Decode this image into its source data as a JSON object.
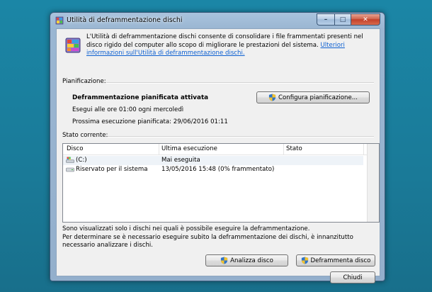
{
  "window": {
    "title": "Utilità di deframmentazione dischi",
    "controls": {
      "minimize": "–",
      "maximize": "□",
      "close": "✕"
    }
  },
  "header": {
    "description": "L'Utilità di deframmentazione dischi consente di consolidare i file frammentati presenti nel disco rigido del computer allo scopo di migliorare le prestazioni del sistema.",
    "link": "Ulteriori informazioni sull'Utilità di deframmentazione dischi."
  },
  "schedule": {
    "section_label": "Pianificazione:",
    "status": "Deframmentazione pianificata attivata",
    "frequency": "Esegui alle ore 01:00 ogni mercoledì",
    "next_run": "Prossima esecuzione pianificata: 29/06/2016 01:11",
    "configure_button": "Configura pianificazione..."
  },
  "current": {
    "section_label": "Stato corrente:",
    "columns": [
      "Disco",
      "Ultima esecuzione",
      "Stato"
    ],
    "rows": [
      {
        "disk": "(C:)",
        "last_run": "Mai eseguita",
        "status": "",
        "icon": "system-drive-icon"
      },
      {
        "disk": "Riservato per il sistema",
        "last_run": "13/05/2016 15:48 (0% frammentato)",
        "status": "",
        "icon": "hard-drive-icon"
      }
    ]
  },
  "footer": {
    "note_line1": "Sono visualizzati solo i dischi nei quali è possibile eseguire la deframmentazione.",
    "note_line2": "Per determinare se è necessario eseguire subito la deframmentazione dei dischi, è innanzitutto necessario analizzare i dischi.",
    "analyze_button": "Analizza disco",
    "defrag_button": "Deframmenta disco",
    "close_button": "Chiudi"
  },
  "colors": {
    "desktop": "#1a7a98",
    "link": "#0b5fd1",
    "close_red": "#c2402a"
  }
}
